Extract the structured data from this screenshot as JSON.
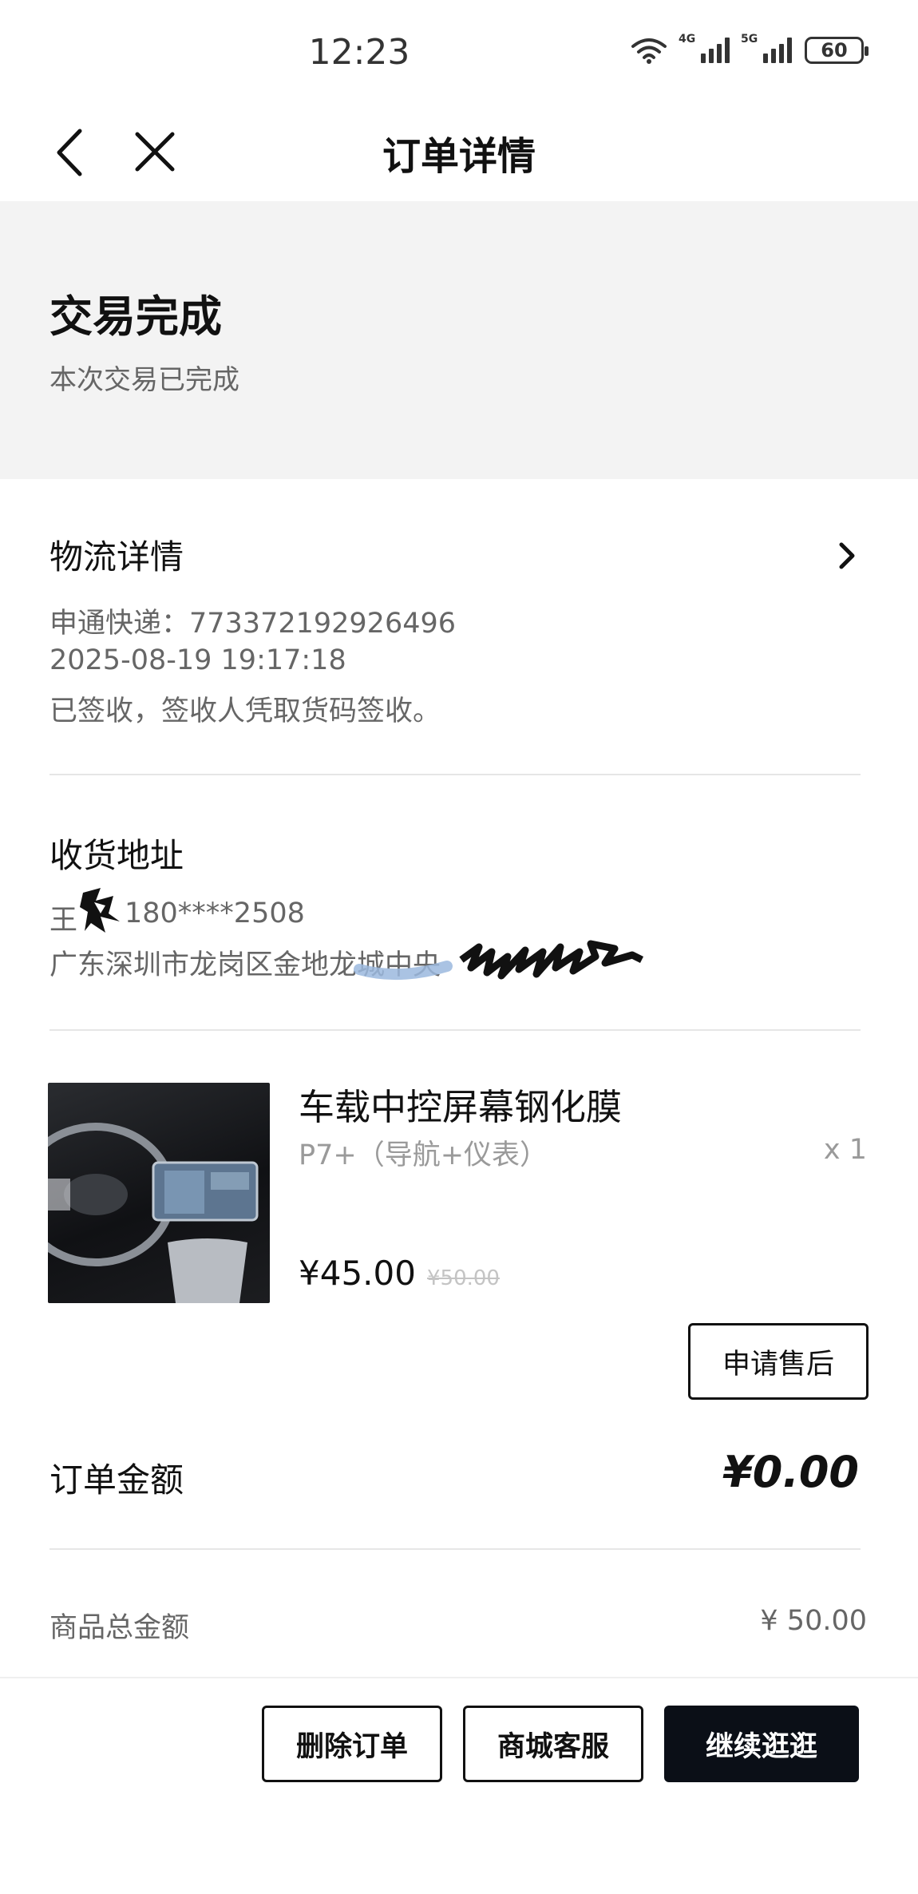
{
  "status_bar": {
    "time": "12:23",
    "network_1": "4G",
    "network_2": "5G",
    "battery": "60"
  },
  "nav": {
    "title": "订单详情",
    "back_icon": "chevron-left-icon",
    "close_icon": "close-icon"
  },
  "order_status": {
    "title": "交易完成",
    "subtitle": "本次交易已完成"
  },
  "logistics": {
    "title": "物流详情",
    "carrier_line": "申通快递：773372192926496",
    "datetime": "2025-08-19 19:17:18",
    "status": "已签收，签收人凭取货码签收。"
  },
  "address": {
    "title": "收货地址",
    "name_prefix": "王",
    "phone": "180****2508",
    "address_prefix": "广东深圳市龙岗区金地龙城中央"
  },
  "product": {
    "name": "车载中控屏幕钢化膜",
    "spec": "P7+（导航+仪表）",
    "quantity": "x 1",
    "price": "¥45.00",
    "original_price": "¥50.00",
    "after_sale_label": "申请售后"
  },
  "summary": {
    "amount_label": "订单金额",
    "amount_value": "¥0.00",
    "total_label": "商品总金额",
    "total_value": "¥ 50.00"
  },
  "actions": {
    "delete": "删除订单",
    "service": "商城客服",
    "continue": "继续逛逛"
  },
  "colors": {
    "banner_bg": "#f3f3f3",
    "primary_button": "#0b0f17",
    "muted_text": "#666666",
    "light_text": "#9a9a9a"
  }
}
